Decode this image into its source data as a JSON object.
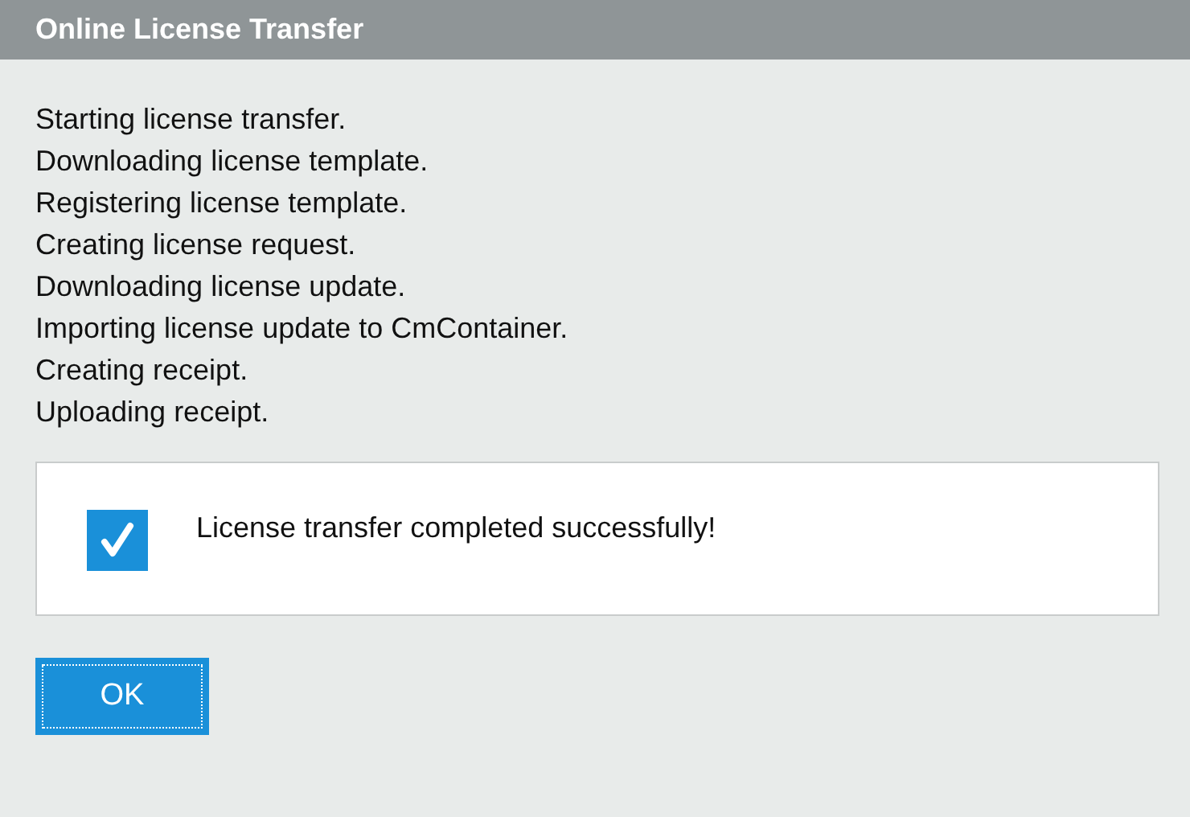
{
  "window": {
    "title": "Online License Transfer"
  },
  "log": [
    "Starting license transfer.",
    "Downloading license template.",
    "Registering license template.",
    "Creating license request.",
    "Downloading license update.",
    "Importing license update to CmContainer.",
    "Creating receipt.",
    "Uploading receipt."
  ],
  "result": {
    "success": true,
    "message": "License transfer completed successfully!"
  },
  "buttons": [
    {
      "label": "OK",
      "focused": true
    }
  ]
}
